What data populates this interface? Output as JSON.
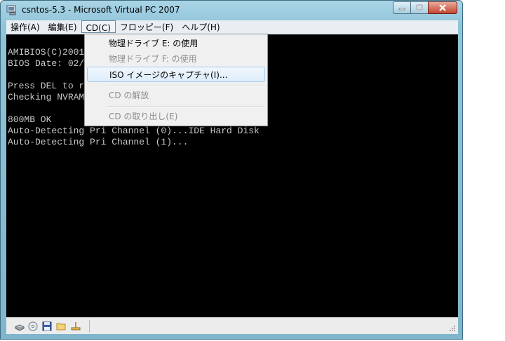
{
  "window": {
    "title": "csntos-5.3 - Microsoft Virtual PC 2007"
  },
  "menubar": {
    "items": [
      {
        "label": "操作(A)"
      },
      {
        "label": "編集(E)"
      },
      {
        "label": "CD(C)"
      },
      {
        "label": "フロッピー(F)"
      },
      {
        "label": "ヘルプ(H)"
      }
    ]
  },
  "cd_menu": {
    "items": [
      {
        "label": "物理ドライブ E: の使用",
        "enabled": true
      },
      {
        "label": "物理ドライブ F: の使用",
        "enabled": false
      },
      {
        "label": "ISO イメージのキャプチャ(I)...",
        "enabled": true,
        "selected": true
      },
      {
        "label": "CD の解放",
        "enabled": false
      },
      {
        "label": "CD の取り出し(E)",
        "enabled": false
      }
    ]
  },
  "console": {
    "lines": [
      "AMIBIOS(C)2001",
      "BIOS Date: 02/",
      "",
      "Press DEL to r",
      "Checking NVRAM",
      "",
      "800MB OK",
      "Auto-Detecting Pri Channel (0)...IDE Hard Disk",
      "Auto-Detecting Pri Channel (1)..."
    ]
  },
  "statusbar": {
    "icons": [
      "hard-disk-icon",
      "cd-drive-icon",
      "floppy-icon",
      "shared-folder-icon",
      "network-icon"
    ]
  }
}
